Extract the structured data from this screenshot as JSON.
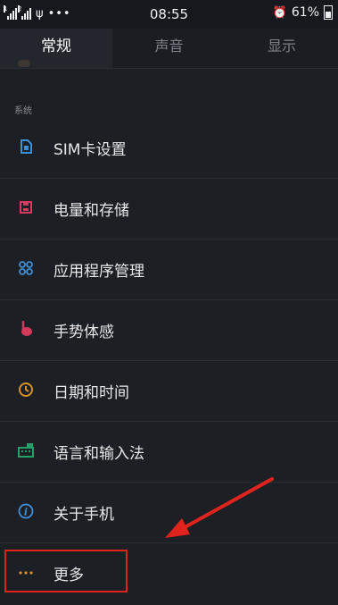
{
  "status_bar": {
    "time": "08:55",
    "battery": "61%",
    "signal1_label": "1",
    "signal2_label": "2"
  },
  "tabs": [
    {
      "label": "常规",
      "active": true
    },
    {
      "label": "声音",
      "active": false
    },
    {
      "label": "显示",
      "active": false
    }
  ],
  "section": {
    "label": "系统"
  },
  "items": [
    {
      "label": "SIM卡设置",
      "icon": "sim-card-icon",
      "color": "#3f8fd8"
    },
    {
      "label": "电量和存储",
      "icon": "storage-icon",
      "color": "#d33a5e"
    },
    {
      "label": "应用程序管理",
      "icon": "apps-icon",
      "color": "#3f8fd8"
    },
    {
      "label": "手势体感",
      "icon": "gesture-icon",
      "color": "#d33a5e"
    },
    {
      "label": "日期和时间",
      "icon": "clock-icon",
      "color": "#d8902a"
    },
    {
      "label": "语言和输入法",
      "icon": "keyboard-icon",
      "color": "#22a36a"
    },
    {
      "label": "关于手机",
      "icon": "info-icon",
      "color": "#3f8fd8"
    },
    {
      "label": "更多",
      "icon": "more-icon",
      "color": "#e0902a"
    }
  ],
  "annotation": {
    "highlight_color": "#e0231c"
  }
}
